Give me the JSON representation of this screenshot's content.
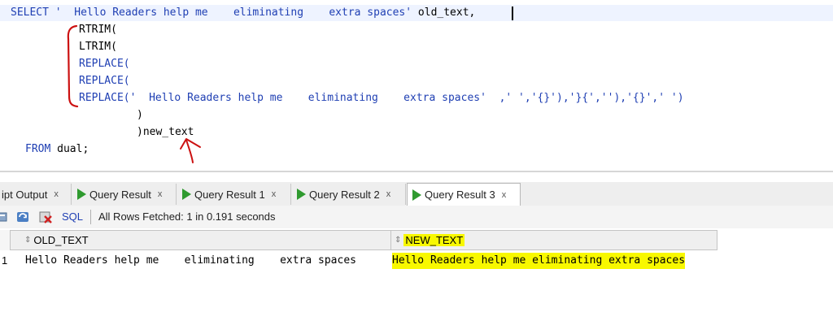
{
  "editor": {
    "line1": {
      "kw": "SELECT",
      "str": " '  Hello Readers help me    eliminating    extra spaces'",
      "rest": " old_text,"
    },
    "line2": "RTRIM(",
    "line3": "LTRIM(",
    "line4": "REPLACE(",
    "line5": "REPLACE(",
    "line6": {
      "kw": "REPLACE(",
      "str": "'  Hello Readers help me    eliminating    extra spaces'  ,' ','{}'),'}{',''),'{}',' ')"
    },
    "line7": ")",
    "line8": ")new_text",
    "line9": {
      "kw": "FROM",
      "rest": " dual;"
    }
  },
  "tabs": [
    {
      "label": "ipt Output",
      "close": "x"
    },
    {
      "label": "Query Result",
      "close": "x"
    },
    {
      "label": "Query Result 1",
      "close": "x"
    },
    {
      "label": "Query Result 2",
      "close": "x"
    },
    {
      "label": "Query Result 3",
      "close": "x",
      "active": true
    }
  ],
  "toolbar": {
    "sql_label": "SQL",
    "status": "All Rows Fetched: 1 in 0.191 seconds"
  },
  "grid": {
    "columns": [
      "OLD_TEXT",
      "NEW_TEXT"
    ],
    "rows": [
      {
        "num": "1",
        "old_text": "Hello Readers help me    eliminating    extra spaces",
        "new_text": "Hello Readers help me eliminating extra spaces"
      }
    ]
  },
  "colors": {
    "keyword": "#1f3fb3",
    "highlight": "#f8f800",
    "annotation": "#cc1111",
    "run_icon": "#2f9a2f"
  }
}
